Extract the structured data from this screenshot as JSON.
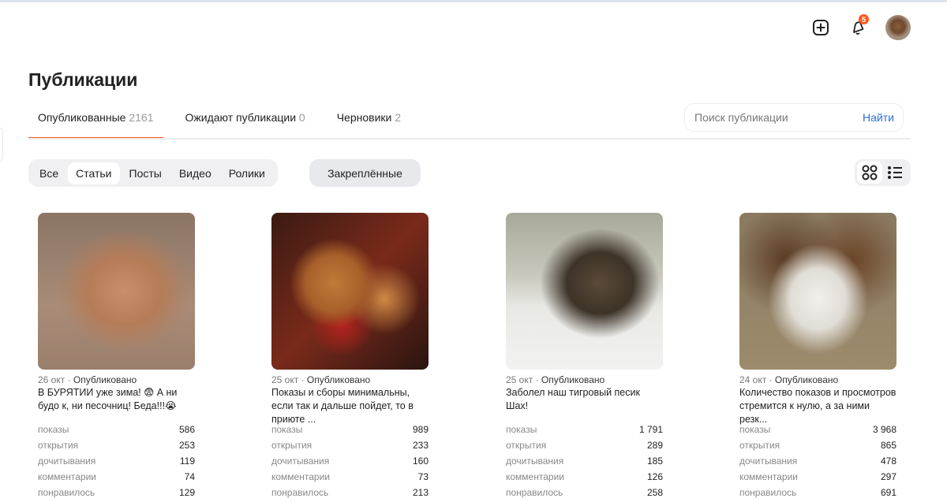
{
  "header": {
    "notifications_count": "5"
  },
  "page_title": "Публикации",
  "tabs": [
    {
      "label": "Опубликованные",
      "count": "2161"
    },
    {
      "label": "Ожидают публикации",
      "count": "0"
    },
    {
      "label": "Черновики",
      "count": "2"
    }
  ],
  "search": {
    "placeholder": "Поиск публикации",
    "button": "Найти"
  },
  "filters": [
    "Все",
    "Статьи",
    "Посты",
    "Видео",
    "Ролики"
  ],
  "active_filter": "Статьи",
  "pinned_label": "Закреплённые",
  "accent_color": "#ff5a1f",
  "stat_labels": [
    "показы",
    "открытия",
    "дочитывания",
    "комментарии",
    "понравилось"
  ],
  "cards": [
    {
      "date": "26 окт",
      "status": "Опубликовано",
      "title": "В БУРЯТИИ уже зима! 😨 А ни будо к, ни песочниц! Беда!!!😭",
      "stats": [
        "586",
        "253",
        "119",
        "74",
        "129"
      ]
    },
    {
      "date": "25 окт",
      "status": "Опубликовано",
      "title": "Показы и сборы минимальны, если так и дальше пойдет, то в приюте ...",
      "stats": [
        "989",
        "233",
        "160",
        "73",
        "213"
      ]
    },
    {
      "date": "25 окт",
      "status": "Опубликовано",
      "title": "Заболел наш тигровый песик Шах!",
      "stats": [
        "1 791",
        "289",
        "185",
        "126",
        "258"
      ]
    },
    {
      "date": "24 окт",
      "status": "Опубликовано",
      "title": "Количество показов и просмотров стремится к нулю, а за ними резк...",
      "stats": [
        "3 968",
        "865",
        "478",
        "297",
        "691"
      ]
    }
  ]
}
